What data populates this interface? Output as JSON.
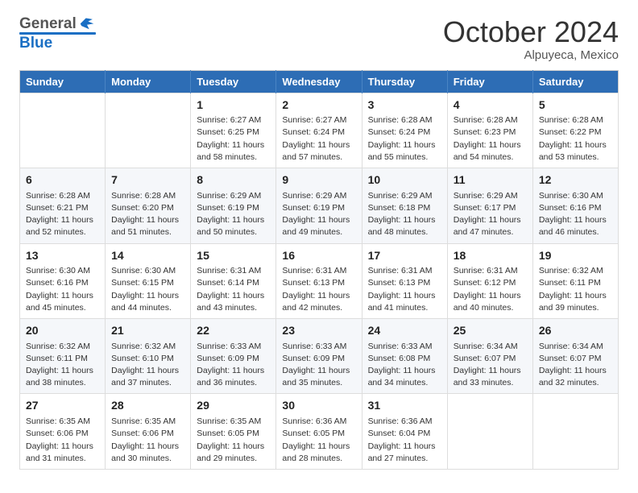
{
  "header": {
    "logo_line1": "General",
    "logo_line2": "Blue",
    "month": "October 2024",
    "location": "Alpuyeca, Mexico"
  },
  "weekdays": [
    "Sunday",
    "Monday",
    "Tuesday",
    "Wednesday",
    "Thursday",
    "Friday",
    "Saturday"
  ],
  "weeks": [
    [
      {
        "day": "",
        "info": ""
      },
      {
        "day": "",
        "info": ""
      },
      {
        "day": "1",
        "info": "Sunrise: 6:27 AM\nSunset: 6:25 PM\nDaylight: 11 hours and 58 minutes."
      },
      {
        "day": "2",
        "info": "Sunrise: 6:27 AM\nSunset: 6:24 PM\nDaylight: 11 hours and 57 minutes."
      },
      {
        "day": "3",
        "info": "Sunrise: 6:28 AM\nSunset: 6:24 PM\nDaylight: 11 hours and 55 minutes."
      },
      {
        "day": "4",
        "info": "Sunrise: 6:28 AM\nSunset: 6:23 PM\nDaylight: 11 hours and 54 minutes."
      },
      {
        "day": "5",
        "info": "Sunrise: 6:28 AM\nSunset: 6:22 PM\nDaylight: 11 hours and 53 minutes."
      }
    ],
    [
      {
        "day": "6",
        "info": "Sunrise: 6:28 AM\nSunset: 6:21 PM\nDaylight: 11 hours and 52 minutes."
      },
      {
        "day": "7",
        "info": "Sunrise: 6:28 AM\nSunset: 6:20 PM\nDaylight: 11 hours and 51 minutes."
      },
      {
        "day": "8",
        "info": "Sunrise: 6:29 AM\nSunset: 6:19 PM\nDaylight: 11 hours and 50 minutes."
      },
      {
        "day": "9",
        "info": "Sunrise: 6:29 AM\nSunset: 6:19 PM\nDaylight: 11 hours and 49 minutes."
      },
      {
        "day": "10",
        "info": "Sunrise: 6:29 AM\nSunset: 6:18 PM\nDaylight: 11 hours and 48 minutes."
      },
      {
        "day": "11",
        "info": "Sunrise: 6:29 AM\nSunset: 6:17 PM\nDaylight: 11 hours and 47 minutes."
      },
      {
        "day": "12",
        "info": "Sunrise: 6:30 AM\nSunset: 6:16 PM\nDaylight: 11 hours and 46 minutes."
      }
    ],
    [
      {
        "day": "13",
        "info": "Sunrise: 6:30 AM\nSunset: 6:16 PM\nDaylight: 11 hours and 45 minutes."
      },
      {
        "day": "14",
        "info": "Sunrise: 6:30 AM\nSunset: 6:15 PM\nDaylight: 11 hours and 44 minutes."
      },
      {
        "day": "15",
        "info": "Sunrise: 6:31 AM\nSunset: 6:14 PM\nDaylight: 11 hours and 43 minutes."
      },
      {
        "day": "16",
        "info": "Sunrise: 6:31 AM\nSunset: 6:13 PM\nDaylight: 11 hours and 42 minutes."
      },
      {
        "day": "17",
        "info": "Sunrise: 6:31 AM\nSunset: 6:13 PM\nDaylight: 11 hours and 41 minutes."
      },
      {
        "day": "18",
        "info": "Sunrise: 6:31 AM\nSunset: 6:12 PM\nDaylight: 11 hours and 40 minutes."
      },
      {
        "day": "19",
        "info": "Sunrise: 6:32 AM\nSunset: 6:11 PM\nDaylight: 11 hours and 39 minutes."
      }
    ],
    [
      {
        "day": "20",
        "info": "Sunrise: 6:32 AM\nSunset: 6:11 PM\nDaylight: 11 hours and 38 minutes."
      },
      {
        "day": "21",
        "info": "Sunrise: 6:32 AM\nSunset: 6:10 PM\nDaylight: 11 hours and 37 minutes."
      },
      {
        "day": "22",
        "info": "Sunrise: 6:33 AM\nSunset: 6:09 PM\nDaylight: 11 hours and 36 minutes."
      },
      {
        "day": "23",
        "info": "Sunrise: 6:33 AM\nSunset: 6:09 PM\nDaylight: 11 hours and 35 minutes."
      },
      {
        "day": "24",
        "info": "Sunrise: 6:33 AM\nSunset: 6:08 PM\nDaylight: 11 hours and 34 minutes."
      },
      {
        "day": "25",
        "info": "Sunrise: 6:34 AM\nSunset: 6:07 PM\nDaylight: 11 hours and 33 minutes."
      },
      {
        "day": "26",
        "info": "Sunrise: 6:34 AM\nSunset: 6:07 PM\nDaylight: 11 hours and 32 minutes."
      }
    ],
    [
      {
        "day": "27",
        "info": "Sunrise: 6:35 AM\nSunset: 6:06 PM\nDaylight: 11 hours and 31 minutes."
      },
      {
        "day": "28",
        "info": "Sunrise: 6:35 AM\nSunset: 6:06 PM\nDaylight: 11 hours and 30 minutes."
      },
      {
        "day": "29",
        "info": "Sunrise: 6:35 AM\nSunset: 6:05 PM\nDaylight: 11 hours and 29 minutes."
      },
      {
        "day": "30",
        "info": "Sunrise: 6:36 AM\nSunset: 6:05 PM\nDaylight: 11 hours and 28 minutes."
      },
      {
        "day": "31",
        "info": "Sunrise: 6:36 AM\nSunset: 6:04 PM\nDaylight: 11 hours and 27 minutes."
      },
      {
        "day": "",
        "info": ""
      },
      {
        "day": "",
        "info": ""
      }
    ]
  ]
}
